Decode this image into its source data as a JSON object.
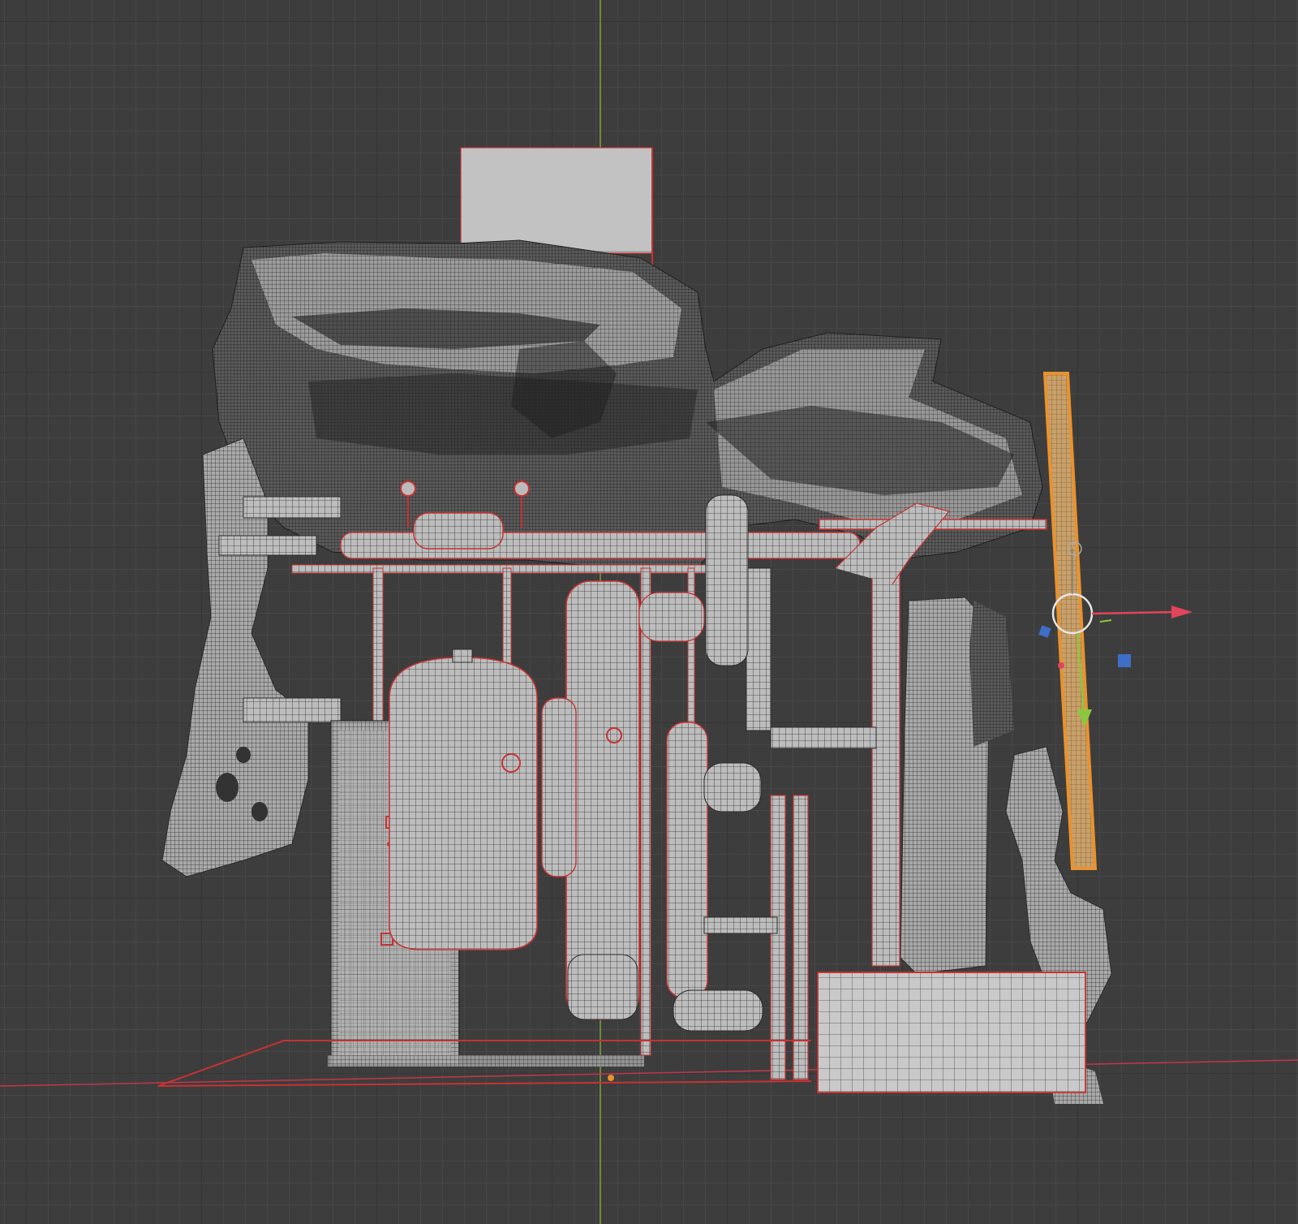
{
  "viewport": {
    "view": "3D Viewport",
    "shading": "wireframe-over-solid",
    "axis_colors": {
      "x_axis": "#c4364a",
      "y_axis": "#7ea23a",
      "z_axis": "#3d6ec8"
    },
    "grid_color": "#474747",
    "background": "#3d3d3d"
  },
  "scene": {
    "mesh_fill": "#b9b9b9",
    "wire_color": "#2b2b2b",
    "selected_edge_color": "#c83232",
    "active_object_color": "#e8922e"
  },
  "gizmo": {
    "type": "move",
    "icons": [
      "move-arrow-x-icon",
      "move-arrow-y-icon",
      "plane-handle-icon",
      "view-circle-icon"
    ]
  }
}
